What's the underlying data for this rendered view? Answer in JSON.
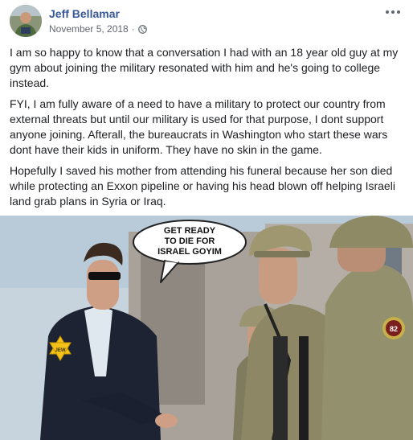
{
  "post": {
    "author": "Jeff Bellamar",
    "date": "November 5, 2018",
    "separator": "·",
    "privacy_icon": "globe-icon",
    "more_icon": "more-options-icon",
    "paragraphs": [
      "I am so happy to know that a conversation I had with an 18 year old guy at my gym about joining the military resonated with him and he's going to college instead.",
      "FYI, I am fully aware of a need to have a military to protect our country from external threats but until our military is used for that purpose, I dont support anyone joining. Afterall, the bureaucrats in Washington who start these wars dont have their kids in uniform. They have no skin in the game.",
      "Hopefully I saved his mother from attending his funeral because her son died while protecting an Exxon pipeline or having his head blown off helping Israeli land grab plans in Syria or Iraq."
    ]
  },
  "meme": {
    "bubble_lines": [
      "GET READY",
      "TO DIE FOR",
      "ISRAEL GOYIM"
    ],
    "star_text": "JEW",
    "patch_text": "82"
  },
  "colors": {
    "link": "#385898",
    "text": "#1c1e21",
    "meta": "#606770"
  }
}
